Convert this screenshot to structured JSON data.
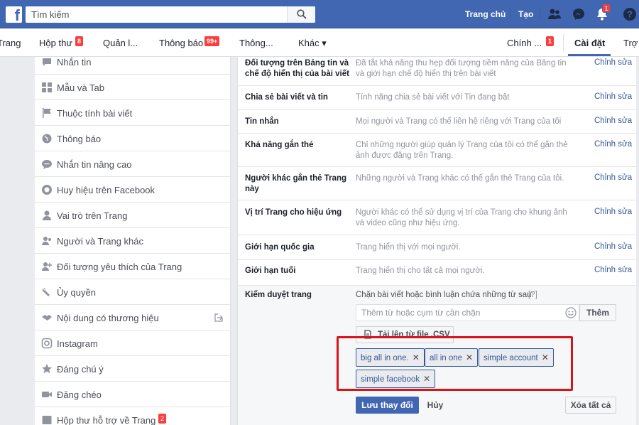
{
  "topbar": {
    "search_placeholder": "Tìm kiếm",
    "home_label": "Trang chủ",
    "create_label": "Tạo",
    "notification_count": "1"
  },
  "tabs": [
    {
      "label": "Trang"
    },
    {
      "label": "Hộp thư",
      "badge": "8"
    },
    {
      "label": "Quản l..."
    },
    {
      "label": "Thông báo",
      "badge": "99+"
    },
    {
      "label": "Thông..."
    },
    {
      "label": "Khác ▾"
    },
    {
      "label": "Chính ...",
      "badge": "1"
    },
    {
      "label": "Cài đặt"
    },
    {
      "label": "Trợ"
    }
  ],
  "sidebar": {
    "items": [
      {
        "label": "Nhắn tin",
        "icon": "message-icon"
      },
      {
        "label": "Mẫu và Tab",
        "icon": "grid-icon"
      },
      {
        "label": "Thuộc tính bài viết",
        "icon": "flag-icon"
      },
      {
        "label": "Thông báo",
        "icon": "globe-icon"
      },
      {
        "label": "Nhắn tin nâng cao",
        "icon": "chat-icon"
      },
      {
        "label": "Huy hiệu trên Facebook",
        "icon": "badge-icon"
      },
      {
        "label": "Vai trò trên Trang",
        "icon": "person-icon"
      },
      {
        "label": "Người và Trang khác",
        "icon": "people-icon"
      },
      {
        "label": "Đối tượng yêu thích của Trang",
        "icon": "audience-icon"
      },
      {
        "label": "Ủy quyền",
        "icon": "wrench-icon"
      },
      {
        "label": "Nội dung có thương hiệu",
        "icon": "handshake-icon"
      },
      {
        "label": "Instagram",
        "icon": "instagram-icon"
      },
      {
        "label": "Đáng chú ý",
        "icon": "star-icon"
      },
      {
        "label": "Đăng chéo",
        "icon": "video-icon"
      },
      {
        "label": "Hộp thư hỗ trợ về Trang",
        "icon": "inbox-icon",
        "badge": "2"
      }
    ]
  },
  "settings": {
    "edit_label": "Chỉnh sửa",
    "rows": [
      {
        "label": "Đối tượng trên Bảng tin và chế độ hiển thị của bài viết",
        "desc": "Đã tắt khả năng thu hẹp đối tượng tiềm năng của Bảng tin và giới hạn chế độ hiển thị trên bài viết"
      },
      {
        "label": "Chia sẻ bài viết và tin",
        "desc": "Tính năng chia sẻ bài viết với Tin đang bật"
      },
      {
        "label": "Tin nhắn",
        "desc": "Mọi người và Trang có thể liên hệ riêng với Trang của tôi"
      },
      {
        "label": "Khả năng gắn thẻ",
        "desc": "Chỉ những người giúp quản lý Trang của tôi có thể gắn thẻ ảnh được đăng trên Trang."
      },
      {
        "label": "Người khác gắn thẻ Trang này",
        "desc": "Những người và Trang khác có thể gắn thẻ Trang của tôi."
      },
      {
        "label": "Vị trí Trang cho hiệu ứng",
        "desc": "Người khác có thể sử dụng vị trí của Trang cho khung ảnh và video cũng như hiệu ứng."
      },
      {
        "label": "Giới hạn quốc gia",
        "desc": "Trang hiển thị với mọi người."
      },
      {
        "label": "Giới hạn tuổi",
        "desc": "Trang hiển thị cho tất cả mọi người."
      }
    ],
    "moderation": {
      "label": "Kiểm duyệt trang",
      "desc": "Chặn bài viết hoặc bình luận chứa những từ sau:",
      "help": "[?]",
      "input_placeholder": "Thêm từ hoặc cụm từ cần chặn",
      "add_label": "Thêm",
      "upload_label": "Tải lên từ file .CSV",
      "tags": [
        "big all in one.",
        "all in one",
        "simple account",
        "simple facebook"
      ],
      "save_label": "Lưu thay đổi",
      "cancel_label": "Hủy",
      "clear_label": "Xóa tất cả"
    }
  },
  "colors": {
    "brand": "#4267b2",
    "badge": "#fa3e3e",
    "link": "#365899",
    "highlight": "#d8141b"
  }
}
